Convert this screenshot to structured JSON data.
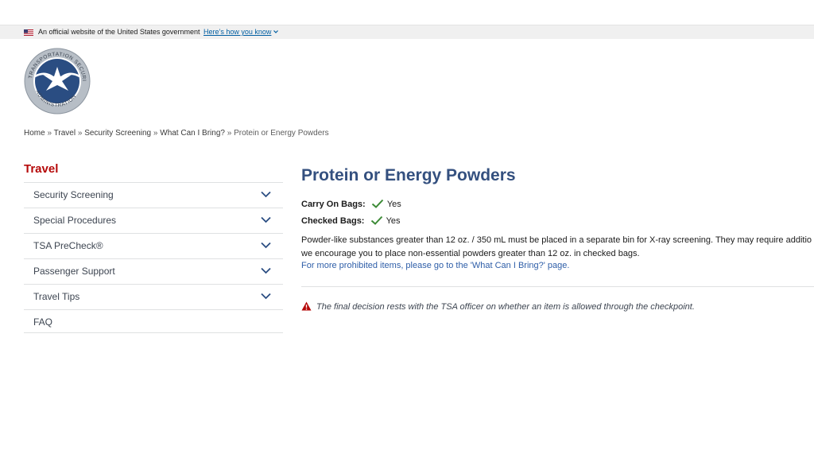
{
  "gov_banner": {
    "text": "An official website of the United States government",
    "link": "Here’s how you know"
  },
  "logo": {
    "top_text": "TRANSPORTATION SECURITY",
    "bottom_text": "ADMINISTRATION",
    "colors": {
      "ring": "#9aa3ad",
      "inner": "#2a4d82",
      "eagle": "#ffffff"
    }
  },
  "breadcrumb": {
    "items": [
      "Home",
      "Travel",
      "Security Screening",
      "What Can I Bring?"
    ],
    "current": "Protein or Energy Powders",
    "separator": "»"
  },
  "sidebar": {
    "title": "Travel",
    "items": [
      {
        "label": "Security Screening",
        "expandable": true
      },
      {
        "label": "Special Procedures",
        "expandable": true
      },
      {
        "label": "TSA PreCheck®",
        "expandable": true
      },
      {
        "label": "Passenger Support",
        "expandable": true
      },
      {
        "label": "Travel Tips",
        "expandable": true
      },
      {
        "label": "FAQ",
        "expandable": false
      }
    ]
  },
  "main": {
    "title": "Protein or Energy Powders",
    "carry_on": {
      "label": "Carry On Bags:",
      "value": "Yes"
    },
    "checked": {
      "label": "Checked Bags:",
      "value": "Yes"
    },
    "description_line1": "Powder-like substances greater than 12 oz. / 350 mL must be placed in a separate bin for X-ray screening. They may require additio",
    "description_line2": "we encourage you to place non-essential powders greater than 12 oz. in checked bags.",
    "more_link": "For more prohibited items, please go to the 'What Can I Bring?' page.",
    "warning": "The final decision rests with the TSA officer on whether an item is allowed through the checkpoint."
  },
  "colors": {
    "title_blue": "#34507f",
    "sidebar_red": "#b50909",
    "link_blue": "#2e5ea8",
    "check_green": "#3d8b37",
    "warn_red": "#b50909"
  }
}
